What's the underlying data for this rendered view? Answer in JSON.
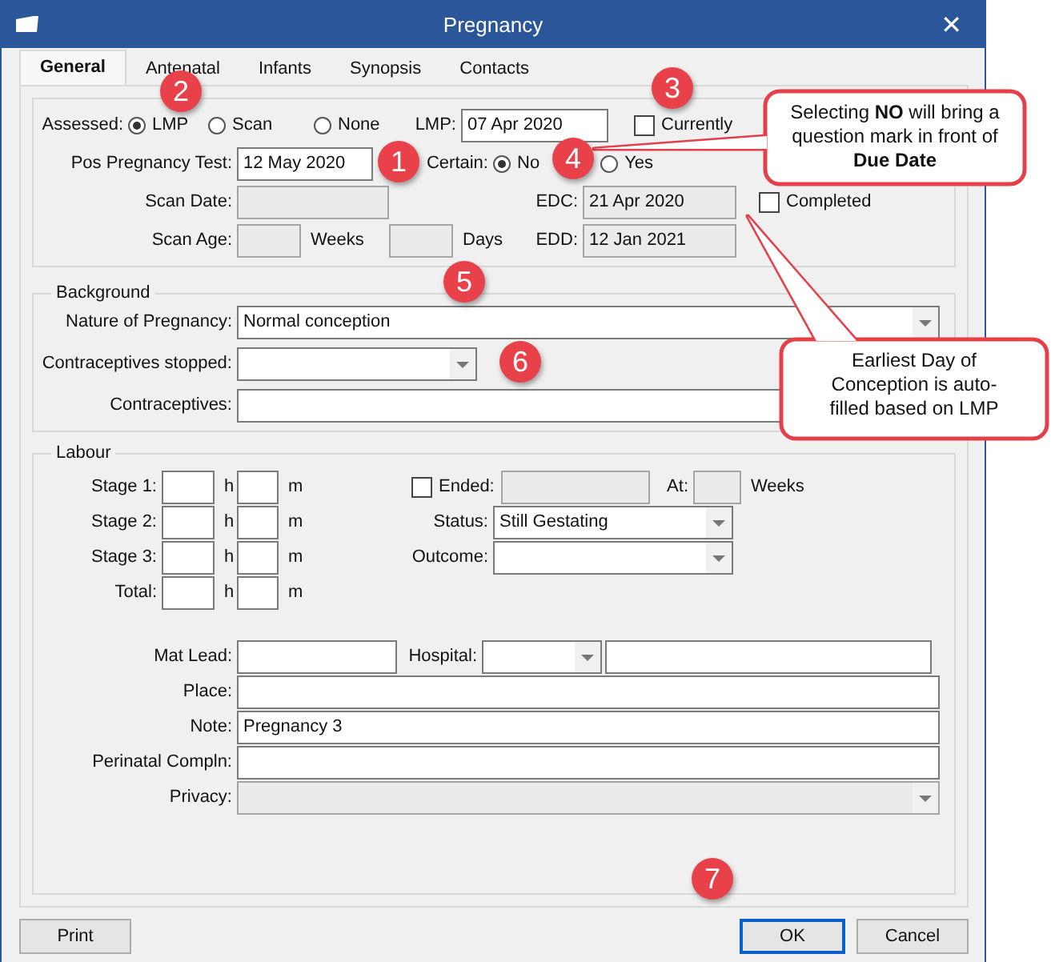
{
  "window": {
    "title": "Pregnancy",
    "close": "✕"
  },
  "tabs": [
    {
      "label": "General",
      "selected": true
    },
    {
      "label": "Antenatal",
      "selected": false
    },
    {
      "label": "Infants",
      "selected": false
    },
    {
      "label": "Synopsis",
      "selected": false
    },
    {
      "label": "Contacts",
      "selected": false
    }
  ],
  "assessment": {
    "assessed": {
      "label": "Assessed:",
      "options": [
        {
          "label": "LMP",
          "selected": true
        },
        {
          "label": "Scan",
          "selected": false
        },
        {
          "label": "None",
          "selected": false
        }
      ]
    },
    "lmp": {
      "label": "LMP:",
      "value": "07 Apr 2020"
    },
    "currently": {
      "label": "Currently",
      "checked": false
    },
    "pos_pregnancy_test": {
      "label": "Pos Pregnancy Test:",
      "value": "12 May 2020"
    },
    "certain": {
      "label": "Certain:",
      "options": [
        {
          "label": "No",
          "selected": true
        },
        {
          "label": "Yes",
          "selected": false
        }
      ]
    },
    "scan_date": {
      "label": "Scan Date:",
      "disabled": true
    },
    "scan_age": {
      "label": "Scan Age:",
      "weeks_unit": "Weeks",
      "days_unit": "Days",
      "disabled": true
    },
    "edc": {
      "label": "EDC:",
      "value": "21 Apr 2020",
      "disabled": true
    },
    "edd": {
      "label": "EDD:",
      "value": "12 Jan 2021",
      "disabled": true
    },
    "completed": {
      "label": "Completed",
      "checked": false
    }
  },
  "background": {
    "legend": "Background",
    "fields": [
      {
        "label": "Nature of Pregnancy:",
        "value": "Normal conception",
        "kind": "dropdown"
      },
      {
        "label": "Contraceptives stopped:",
        "kind": "short-dropdown"
      },
      {
        "label": "Contraceptives:",
        "kind": "text"
      }
    ]
  },
  "labour": {
    "legend": "Labour",
    "stages": [
      {
        "label": "Stage 1:",
        "hours_unit": "h",
        "minutes_unit": "m"
      },
      {
        "label": "Stage 2:",
        "hours_unit": "h",
        "minutes_unit": "m"
      },
      {
        "label": "Stage 3:",
        "hours_unit": "h",
        "minutes_unit": "m"
      },
      {
        "label": "Total:",
        "hours_unit": "h",
        "minutes_unit": "m"
      }
    ],
    "ended": {
      "label": "Ended:",
      "checked": false,
      "at_label": "At:",
      "weeks_unit": "Weeks",
      "disabled": true
    },
    "status": {
      "label": "Status:",
      "value": "Still Gestating"
    },
    "outcome": {
      "label": "Outcome:"
    },
    "mat_lead": {
      "label": "Mat Lead:"
    },
    "hospital": {
      "label": "Hospital:"
    },
    "fields": [
      {
        "label": "Place:",
        "kind": "text"
      },
      {
        "label": "Note:",
        "value": "Pregnancy 3",
        "kind": "text"
      },
      {
        "label": "Perinatal Compln:",
        "kind": "text"
      },
      {
        "label": "Privacy:",
        "kind": "dropdown",
        "disabled": true
      }
    ]
  },
  "buttons": [
    {
      "label": "Print",
      "default": false
    },
    {
      "label": "OK",
      "default": true
    },
    {
      "label": "Cancel",
      "default": false
    }
  ],
  "annotations": {
    "badges": [
      "1",
      "2",
      "3",
      "4",
      "5",
      "6",
      "7"
    ],
    "callouts": [
      {
        "text": "Selecting **NO** will bring a question mark in front of **Due Date**"
      },
      {
        "text": "Earliest Day of Conception is auto-filled based on LMP"
      }
    ]
  }
}
